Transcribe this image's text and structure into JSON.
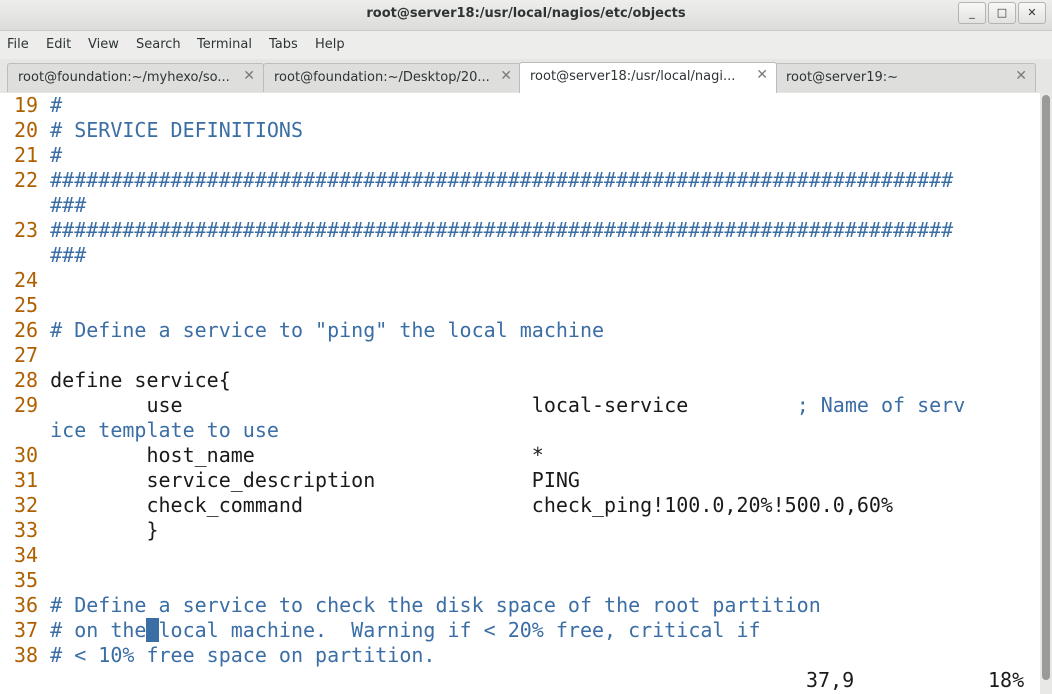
{
  "window": {
    "title": "root@server18:/usr/local/nagios/etc/objects"
  },
  "window_controls": {
    "minimize": "_",
    "maximize": "□",
    "close": "✕"
  },
  "menu": [
    "File",
    "Edit",
    "View",
    "Search",
    "Terminal",
    "Tabs",
    "Help"
  ],
  "tabs": [
    {
      "label": "root@foundation:~/myhexo/so...",
      "close": "✕",
      "active": false
    },
    {
      "label": "root@foundation:~/Desktop/20...",
      "close": "✕",
      "active": false
    },
    {
      "label": "root@server18:/usr/local/nagi...",
      "close": "✕",
      "active": true
    },
    {
      "label": "root@server19:~",
      "close": "✕",
      "active": false
    }
  ],
  "editor": {
    "lines": [
      {
        "num": "19",
        "segments": [
          {
            "text": " #",
            "style": "cmt"
          }
        ]
      },
      {
        "num": "20",
        "segments": [
          {
            "text": " # SERVICE DEFINITIONS",
            "style": "cmt"
          }
        ]
      },
      {
        "num": "21",
        "segments": [
          {
            "text": " #",
            "style": "cmt"
          }
        ]
      },
      {
        "num": "22",
        "segments": [
          {
            "text": " ###########################################################################",
            "style": "cmt"
          }
        ]
      },
      {
        "num": "",
        "segments": [
          {
            "text": "   ###",
            "style": "cmt"
          }
        ]
      },
      {
        "num": "23",
        "segments": [
          {
            "text": " ###########################################################################",
            "style": "cmt"
          }
        ]
      },
      {
        "num": "",
        "segments": [
          {
            "text": "   ###",
            "style": "cmt"
          }
        ]
      },
      {
        "num": "24",
        "segments": []
      },
      {
        "num": "25",
        "segments": []
      },
      {
        "num": "26",
        "segments": [
          {
            "text": " # Define a service to \"ping\" the local machine",
            "style": "cmt"
          }
        ]
      },
      {
        "num": "27",
        "segments": []
      },
      {
        "num": "28",
        "segments": [
          {
            "text": " define service{",
            "style": "txt"
          }
        ]
      },
      {
        "num": "29",
        "segments": [
          {
            "text": "         use                             local-service         ",
            "style": "txt"
          },
          {
            "text": "; Name of serv",
            "style": "cmt"
          }
        ]
      },
      {
        "num": "",
        "segments": [
          {
            "text": "   ice template to use",
            "style": "cmt"
          }
        ]
      },
      {
        "num": "30",
        "segments": [
          {
            "text": "         host_name                       *",
            "style": "txt"
          }
        ]
      },
      {
        "num": "31",
        "segments": [
          {
            "text": "         service_description             PING",
            "style": "txt"
          }
        ]
      },
      {
        "num": "32",
        "segments": [
          {
            "text": "         check_command                   check_ping!100.0,20%!500.0,60%",
            "style": "txt"
          }
        ]
      },
      {
        "num": "33",
        "segments": [
          {
            "text": "         }",
            "style": "txt"
          }
        ]
      },
      {
        "num": "34",
        "segments": []
      },
      {
        "num": "35",
        "segments": []
      },
      {
        "num": "36",
        "segments": [
          {
            "text": " # Define a service to check the disk space of the root partition",
            "style": "cmt"
          }
        ]
      },
      {
        "num": "37",
        "segments": [
          {
            "text": " # on the",
            "style": "cmt"
          },
          {
            "text": " ",
            "style": "cursor"
          },
          {
            "text": "local machine.  Warning if < 20% free, critical if",
            "style": "cmt"
          }
        ]
      },
      {
        "num": "38",
        "segments": [
          {
            "text": " # < 10% free space on partition.",
            "style": "cmt"
          }
        ]
      }
    ],
    "status": {
      "position": "37,9",
      "percent": "18%"
    }
  }
}
